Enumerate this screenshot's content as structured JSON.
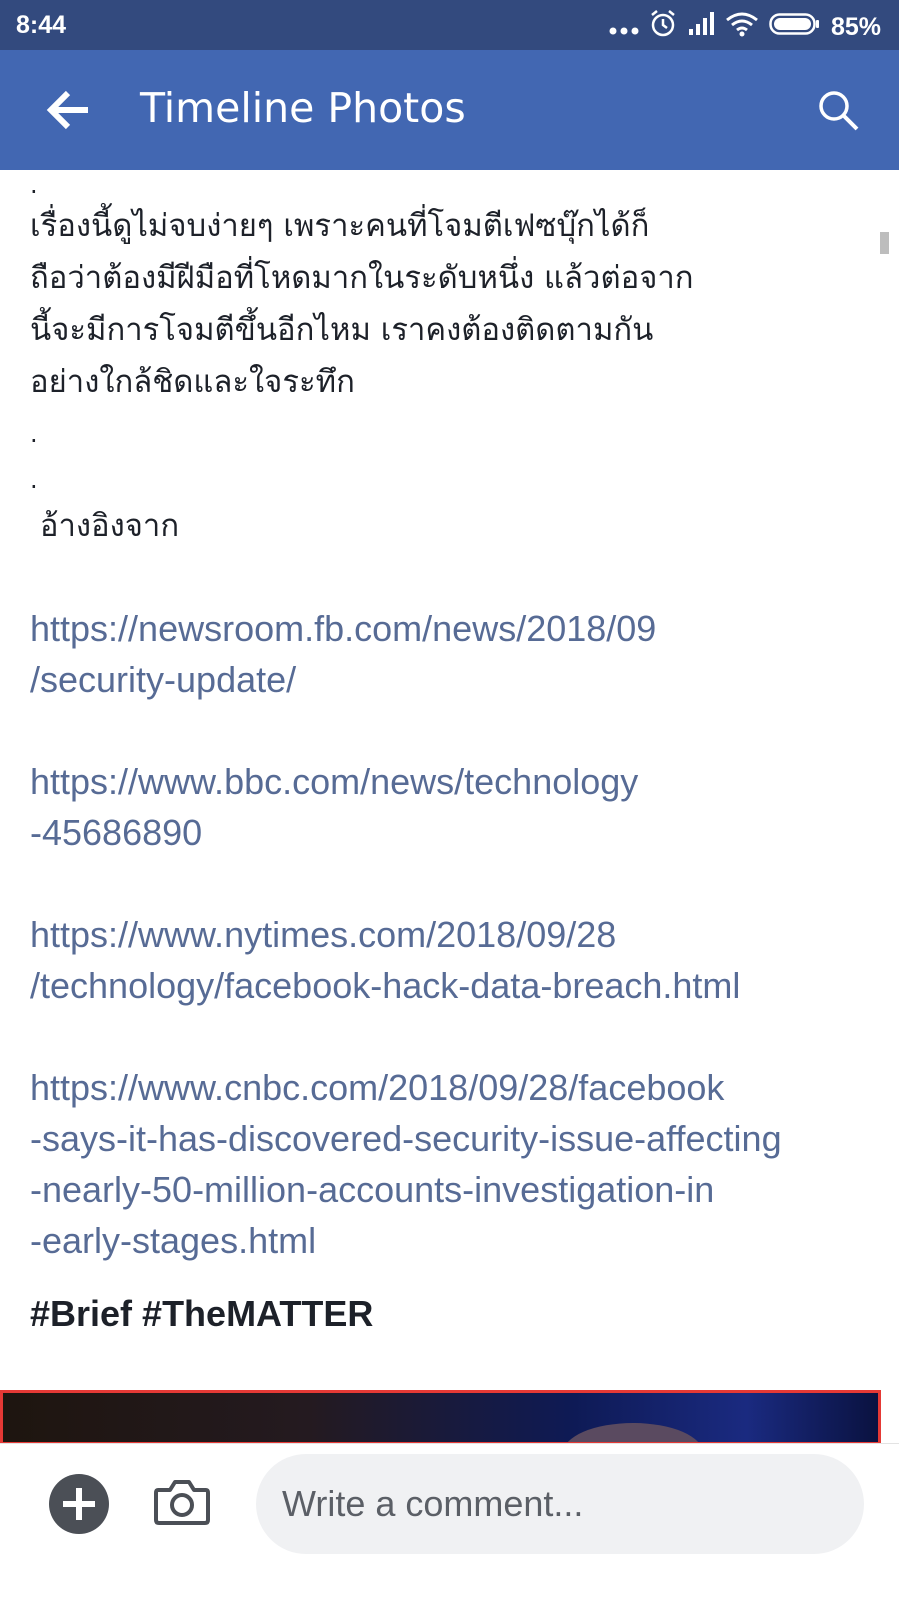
{
  "status_bar": {
    "time": "8:44",
    "battery_percent": "85%",
    "icons": [
      "more-dots-icon",
      "alarm-icon",
      "signal-icon",
      "wifi-icon",
      "battery-icon"
    ]
  },
  "app_bar": {
    "title": "Timeline Photos",
    "back_icon": "arrow-left-icon",
    "search_icon": "search-icon",
    "color": "#4267b2"
  },
  "post": {
    "leading_dot": ".",
    "paragraph": "เรื่องนี้ดูไม่จบง่ายๆ เพราะคนที่โจมตีเฟซบุ๊กได้ก็\nถือว่าต้องมีฝีมือที่โหดมากในระดับหนึ่ง แล้วต่อจาก\nนี้จะมีการโจมตีขึ้นอีกไหม เราคงต้องติดตามกัน\nอย่างใกล้ชิดและใจระทึก",
    "dot_2": ".",
    "dot_3": ".",
    "reference_label": " อ้างอิงจาก",
    "links": [
      "https://newsroom.fb.com/news/2018/09\n/security-update/",
      "https://www.bbc.com/news/technology\n-45686890",
      "https://www.nytimes.com/2018/09/28\n/technology/facebook-hack-data-breach.html",
      "https://www.cnbc.com/2018/09/28/facebook\n-says-it-has-discovered-security-issue-affecting\n-nearly-50-million-accounts-investigation-in\n-early-stages.html"
    ],
    "hashtags": "#Brief #TheMATTER",
    "link_color": "#576b95"
  },
  "comment_bar": {
    "add_icon": "plus-circle-icon",
    "camera_icon": "camera-icon",
    "placeholder": "Write a comment..."
  }
}
